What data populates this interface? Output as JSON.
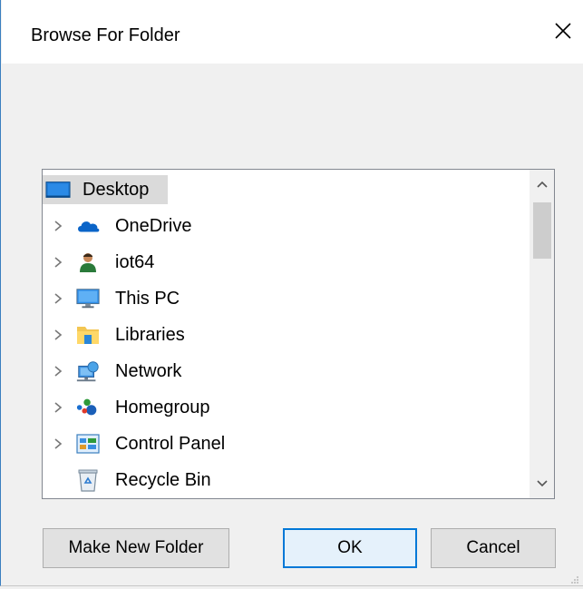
{
  "dialog": {
    "title": "Browse For Folder",
    "close_icon": "close-icon"
  },
  "tree": {
    "items": [
      {
        "label": "Desktop",
        "icon": "desktop-icon",
        "expandable": false,
        "selected": true
      },
      {
        "label": "OneDrive",
        "icon": "onedrive-cloud-icon",
        "expandable": true
      },
      {
        "label": "iot64",
        "icon": "user-icon",
        "expandable": true
      },
      {
        "label": "This PC",
        "icon": "this-pc-monitor-icon",
        "expandable": true
      },
      {
        "label": "Libraries",
        "icon": "libraries-folder-icon",
        "expandable": true
      },
      {
        "label": "Network",
        "icon": "network-icon",
        "expandable": true
      },
      {
        "label": "Homegroup",
        "icon": "homegroup-icon",
        "expandable": true
      },
      {
        "label": "Control Panel",
        "icon": "control-panel-icon",
        "expandable": true
      },
      {
        "label": "Recycle Bin",
        "icon": "recycle-bin-icon",
        "expandable": false
      }
    ]
  },
  "buttons": {
    "make_new_folder": "Make New Folder",
    "ok": "OK",
    "cancel": "Cancel"
  },
  "colors": {
    "accent": "#0078d7",
    "selection": "#dadada"
  }
}
